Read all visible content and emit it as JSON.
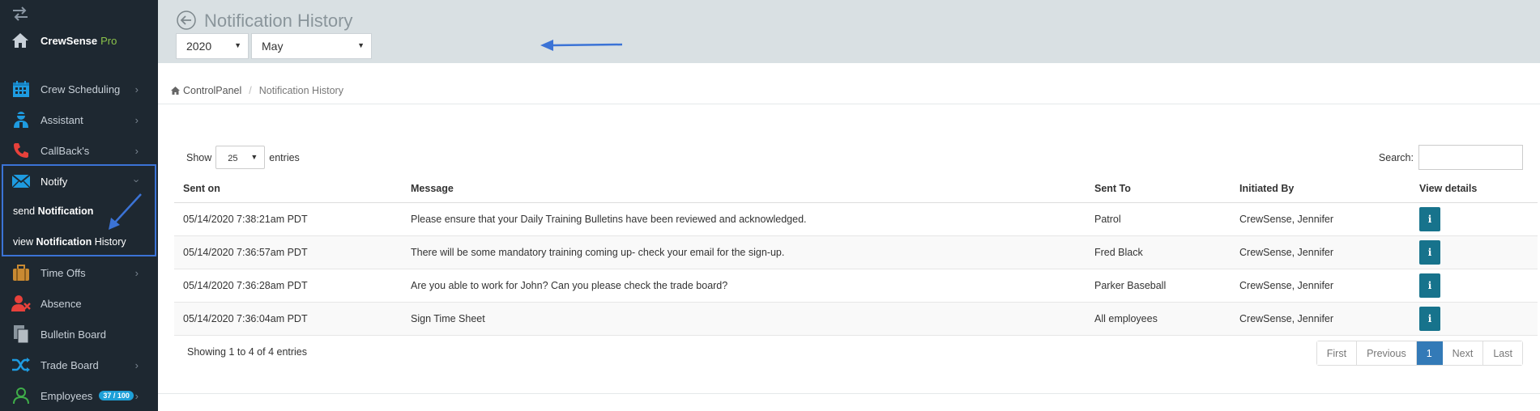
{
  "sidebar": {
    "brand": {
      "name": "CrewSense",
      "suffix": "Pro"
    },
    "items": [
      {
        "label": "Crew Scheduling",
        "icon": "calendar-icon"
      },
      {
        "label": "Assistant",
        "icon": "assistant-icon"
      },
      {
        "label": "CallBack's",
        "icon": "phone-icon"
      },
      {
        "label": "Notify",
        "icon": "envelope-icon"
      },
      {
        "label": "Time Offs",
        "icon": "suitcase-icon"
      },
      {
        "label": "Absence",
        "icon": "user-x-icon"
      },
      {
        "label": "Bulletin Board",
        "icon": "documents-icon"
      },
      {
        "label": "Trade Board",
        "icon": "shuffle-icon"
      },
      {
        "label": "Employees",
        "icon": "user-icon",
        "badge": "37 / 100"
      }
    ],
    "notify_sub": {
      "send": {
        "prefix": "send",
        "bold": "Notification"
      },
      "view": {
        "prefix": "view",
        "bold": "Notification",
        "suffix": "History"
      }
    }
  },
  "header": {
    "title": "Notification History",
    "year": "2020",
    "month": "May"
  },
  "breadcrumb": {
    "home": "ControlPanel",
    "current": "Notification History"
  },
  "table_controls": {
    "show_label": "Show",
    "page_length": "25",
    "entries_label": "entries",
    "search_label": "Search:",
    "search_value": ""
  },
  "table": {
    "columns": [
      "Sent on",
      "Message",
      "Sent To",
      "Initiated By",
      "View details"
    ],
    "rows": [
      {
        "sent_on": "05/14/2020 7:38:21am PDT",
        "message": "Please ensure that your Daily Training Bulletins have been reviewed and acknowledged.",
        "sent_to": "Patrol",
        "initiated_by": "CrewSense, Jennifer"
      },
      {
        "sent_on": "05/14/2020 7:36:57am PDT",
        "message": "There will be some mandatory training coming up- check your email for the sign-up.",
        "sent_to": "Fred Black",
        "initiated_by": "CrewSense, Jennifer"
      },
      {
        "sent_on": "05/14/2020 7:36:28am PDT",
        "message": "Are you able to work for John? Can you please check the trade board?",
        "sent_to": "Parker Baseball",
        "initiated_by": "CrewSense, Jennifer"
      },
      {
        "sent_on": "05/14/2020 7:36:04am PDT",
        "message": "Sign Time Sheet",
        "sent_to": "All employees",
        "initiated_by": "CrewSense, Jennifer"
      }
    ],
    "info_button": "i"
  },
  "footer": {
    "info": "Showing 1 to 4 of 4 entries",
    "pager": [
      "First",
      "Previous",
      "1",
      "Next",
      "Last"
    ]
  },
  "colors": {
    "sidebar_bg": "#1e2831",
    "header_bg": "#d9e0e3",
    "accent_blue": "#3b73d6",
    "info_button": "#17738c",
    "pager_active": "#337ab7"
  }
}
